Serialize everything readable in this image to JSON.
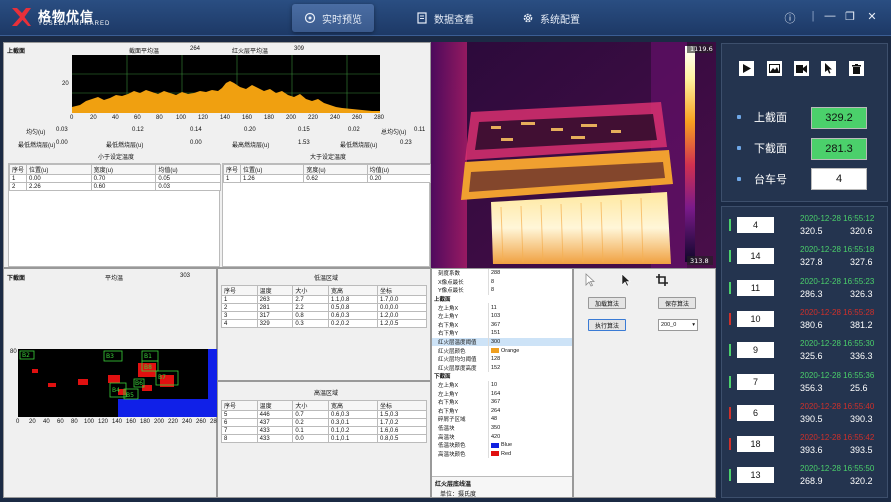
{
  "app": {
    "logo_cn": "格物优信",
    "logo_en": "YOSEEN INFRARED"
  },
  "tabs": [
    {
      "label": "实时预览",
      "icon": "camera-icon",
      "active": true
    },
    {
      "label": "数据查看",
      "icon": "document-icon",
      "active": false
    },
    {
      "label": "系统配置",
      "icon": "gear-icon",
      "active": false
    }
  ],
  "window": {
    "info": "ⓘ",
    "minimize": "—",
    "restore": "❐",
    "close": "✕"
  },
  "profile": {
    "title": "上截面",
    "avg_label": "截面平均温",
    "avg_value": "264",
    "fire_label": "红火层平均温",
    "fire_value": "309",
    "y_tick": "20",
    "x_ticks": [
      "0",
      "20",
      "40",
      "60",
      "80",
      "100",
      "120",
      "140",
      "160",
      "180",
      "200",
      "220",
      "240",
      "260",
      "280"
    ],
    "stats_row1": [
      {
        "label": "均匀(u)",
        "value": "0.03"
      },
      {
        "label": "",
        "value": "0.12"
      },
      {
        "label": "",
        "value": "0.14"
      },
      {
        "label": "",
        "value": "0.20"
      },
      {
        "label": "",
        "value": "0.15"
      },
      {
        "label": "",
        "value": "0.02"
      },
      {
        "label": "总均匀(u)",
        "value": "0.11"
      }
    ],
    "stats_row2": [
      {
        "label": "最低燃烧层(u)",
        "value": "0.00"
      },
      {
        "label": "最低燃烧层(u)",
        "value": "0.00"
      },
      {
        "label": "最高燃烧层(u)",
        "value": "1.53"
      },
      {
        "label": "最低燃烧层(u)",
        "value": "0.23"
      }
    ],
    "low_title": "小于设定温度",
    "high_title": "大于设定温度",
    "low_headers": [
      "序号",
      "位置(u)",
      "宽度(u)",
      "均值(u)"
    ],
    "low_rows": [
      [
        "1",
        "0.00",
        "0.70",
        "0.05"
      ],
      [
        "2",
        "2.26",
        "0.60",
        "0.03"
      ]
    ],
    "high_headers": [
      "序号",
      "位置(u)",
      "宽度(u)",
      "均值(u)"
    ],
    "high_rows": [
      [
        "1",
        "1.26",
        "0.62",
        "0.20"
      ]
    ]
  },
  "lower": {
    "title": "下截面",
    "avg_label": "平均温",
    "avg_value": "303",
    "y_tick": "80",
    "x_ticks": [
      "0",
      "20",
      "40",
      "60",
      "80",
      "100",
      "120",
      "140",
      "160",
      "180",
      "200",
      "220",
      "240",
      "260",
      "280"
    ],
    "box_labels": [
      "B2",
      "B3",
      "B1",
      "B4",
      "B5",
      "B6",
      "B7",
      "B8"
    ]
  },
  "low_region": {
    "title": "低温区域",
    "headers": [
      "序号",
      "温度",
      "大小",
      "宽高",
      "坐标"
    ],
    "rows": [
      [
        "1",
        "263",
        "2.7",
        "1.1,0.8",
        "1.7,0.0"
      ],
      [
        "2",
        "281",
        "2.2",
        "0.5,0.8",
        "0.0,0.0"
      ],
      [
        "3",
        "317",
        "0.8",
        "0.6,0.3",
        "1.2,0.0"
      ],
      [
        "4",
        "329",
        "0.3",
        "0.2,0.2",
        "1.2,0.5"
      ]
    ]
  },
  "high_region": {
    "title": "高温区域",
    "headers": [
      "序号",
      "温度",
      "大小",
      "宽高",
      "坐标"
    ],
    "rows": [
      [
        "5",
        "446",
        "0.7",
        "0.6,0.3",
        "1.5,0.3"
      ],
      [
        "6",
        "437",
        "0.2",
        "0.3,0.1",
        "1.7,0.2"
      ],
      [
        "7",
        "433",
        "0.1",
        "0.1,0.2",
        "1.6,0.6"
      ],
      [
        "8",
        "433",
        "0.0",
        "0.1,0.1",
        "0.8,0.5"
      ]
    ]
  },
  "thermal": {
    "scale_max": "1119.6",
    "scale_min": "313.8"
  },
  "properties": [
    {
      "k": "刻度系数",
      "v": "288"
    },
    {
      "k": "X像点最长",
      "v": "8"
    },
    {
      "k": "Y像点最长",
      "v": "8"
    },
    {
      "k": "上截面",
      "v": "",
      "header": true
    },
    {
      "k": "左上角X",
      "v": "11"
    },
    {
      "k": "左上角Y",
      "v": "103"
    },
    {
      "k": "右下角X",
      "v": "367"
    },
    {
      "k": "右下角Y",
      "v": "151"
    },
    {
      "k": "红火层温度阈值",
      "v": "300",
      "sel": true
    },
    {
      "k": "红火层颜色",
      "v": "Orange",
      "swatch": "#f0a020"
    },
    {
      "k": "红火层均匀阈值",
      "v": "128"
    },
    {
      "k": "红火层厚度高度",
      "v": "152"
    },
    {
      "k": "下截面",
      "v": "",
      "header": true
    },
    {
      "k": "左上角X",
      "v": "10"
    },
    {
      "k": "左上角Y",
      "v": "164"
    },
    {
      "k": "右下角X",
      "v": "367"
    },
    {
      "k": "右下角Y",
      "v": "264"
    },
    {
      "k": "碎屑子区域",
      "v": "48"
    },
    {
      "k": "低温块",
      "v": "350"
    },
    {
      "k": "高温块",
      "v": "420"
    },
    {
      "k": "低温块颜色",
      "v": "Blue",
      "swatch": "#1020e0"
    },
    {
      "k": "高温块颜色",
      "v": "Red",
      "swatch": "#e01010"
    }
  ],
  "prop_footer": {
    "title": "红火层底线温",
    "desc": "单位：摄氏度"
  },
  "controls": {
    "load_algo": "加载算法",
    "save_algo": "保存算法",
    "run_algo": "执行算法",
    "select_value": "200_0"
  },
  "summary": {
    "upper_label": "上截面",
    "upper_value": "329.2",
    "lower_label": "下截面",
    "lower_value": "281.3",
    "cart_label": "台车号",
    "cart_value": "4"
  },
  "records": [
    {
      "num": "4",
      "ts": "2020-12-28 16:55:12",
      "v1": "320.5",
      "v2": "320.6",
      "status": "ok"
    },
    {
      "num": "14",
      "ts": "2020-12-28 16:55:18",
      "v1": "327.8",
      "v2": "327.6",
      "status": "ok"
    },
    {
      "num": "11",
      "ts": "2020-12-28 16:55:23",
      "v1": "286.3",
      "v2": "326.3",
      "status": "ok"
    },
    {
      "num": "10",
      "ts": "2020-12-28 16:55:28",
      "v1": "380.6",
      "v2": "381.2",
      "status": "alarm"
    },
    {
      "num": "9",
      "ts": "2020-12-28 16:55:30",
      "v1": "325.6",
      "v2": "336.3",
      "status": "ok"
    },
    {
      "num": "7",
      "ts": "2020-12-28 16:55:36",
      "v1": "356.3",
      "v2": "25.6",
      "status": "ok"
    },
    {
      "num": "6",
      "ts": "2020-12-28 16:55:40",
      "v1": "390.5",
      "v2": "390.3",
      "status": "alarm"
    },
    {
      "num": "18",
      "ts": "2020-12-28 16:55:42",
      "v1": "393.6",
      "v2": "393.5",
      "status": "alarm"
    },
    {
      "num": "13",
      "ts": "2020-12-28 16:55:50",
      "v1": "268.9",
      "v2": "320.2",
      "status": "ok"
    }
  ],
  "colors": {
    "ok": "#4bd06b",
    "alarm": "#d0302a",
    "accent": "#6fa8e8"
  }
}
